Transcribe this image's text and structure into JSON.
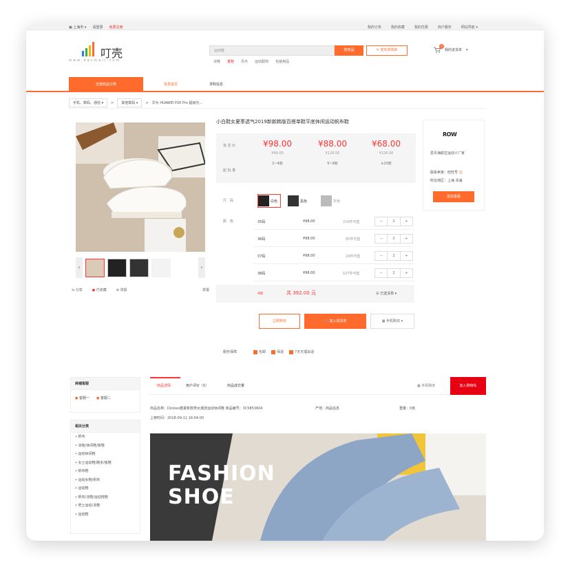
{
  "topbar": {
    "city": "上海市",
    "login": "请登录",
    "register": "免费注册",
    "links": [
      "我的订单",
      "我的收藏",
      "我的优惠",
      "商户服务",
      "网站导航"
    ]
  },
  "brand": {
    "name": "叮壳",
    "url": "www.dacmall.com"
  },
  "search": {
    "placeholder": "运动鞋",
    "button": "搜商品",
    "publish": "发布求购单",
    "hot_words": [
      "凉鞋",
      "童鞋",
      "丹杰",
      "运动服饰",
      "包装用品"
    ]
  },
  "cart": {
    "label": "我的进货单",
    "count": "0"
  },
  "nav": {
    "tabs": [
      "全部商品分类",
      "批发首页",
      "求购信息"
    ]
  },
  "breadcrumb": {
    "cat1": "手机、数码、通信",
    "cat2": "其他数码",
    "current": "华为 HUAWEI P20 Pro 超级光..."
  },
  "product": {
    "title": "小白鞋女夏季透气2019新款韩版百搭单鞋平底休闲运动帆布鞋",
    "price_label": "批 发 价",
    "qty_label": "起 批 量",
    "tiers": [
      {
        "price": "¥98.00",
        "orig": "¥99.00",
        "qty": "1~4双"
      },
      {
        "price": "¥88.00",
        "orig": "¥126.00",
        "qty": "5~9双"
      },
      {
        "price": "¥68.00",
        "orig": "¥126.00",
        "qty": "≥10双"
      }
    ],
    "style_label": "尺　码",
    "styles": [
      "白色",
      "黑色",
      "灰色"
    ],
    "color_label": "颜　色",
    "sizes": [
      {
        "size": "35码",
        "price": "¥98.00",
        "stock": "216件可售",
        "qty": "2"
      },
      {
        "size": "36码",
        "price": "¥98.00",
        "stock": "85件可售",
        "qty": "2"
      },
      {
        "size": "37码",
        "price": "¥98.00",
        "stock": "24件可售",
        "qty": "2"
      },
      {
        "size": "38码",
        "price": "¥98.00",
        "stock": "107件可售",
        "qty": "2"
      }
    ],
    "total_count": "4双",
    "total_price": "共 392.00 元",
    "selected": "已选清单",
    "buy_now": "立即购买",
    "add_cart": "加入进货单",
    "mobile_buy": "手机购买",
    "service_label": "服务保障",
    "services": [
      "包邮",
      "保退",
      "7天无理由退"
    ]
  },
  "gallery": {
    "share": "分享",
    "fav": "已收藏",
    "report": "举报",
    "more": "举报"
  },
  "seller": {
    "logo": "ROW",
    "name": "爱丹海航拉运动人厂家",
    "contact_label": "联系卖家：",
    "contact": "旺旺号",
    "region_label": "所在地区：",
    "region": "上海 青浦",
    "button": "进店看看"
  },
  "sidebar": {
    "service_title": "商铺客服",
    "agents": [
      "客服一",
      "客服二"
    ],
    "category_title": "相关分类",
    "categories": [
      "帆布",
      "凉拖/休闲鞋/板鞋",
      "运动休闲鞋",
      "女士运动鞋/跑步/板鞋",
      "帆布鞋",
      "运动女鞋/帆布",
      "运动鞋",
      "帆布/凉鞋/运动拖鞋",
      "男士运动/凉鞋",
      "运动鞋"
    ]
  },
  "detail": {
    "tabs": [
      "商品详情",
      "用户评价（5）",
      "商品成交量"
    ],
    "mobile": "手机购买",
    "add_cart": "加入购物车",
    "attr_name": "商品名称：Dickies春夏新款男女潮流运动休闲鞋 商品编号：3C5853604",
    "attr_origin": "产地：商品信息",
    "attr_weight": "重量：0克",
    "attr_time": "上架时间：2018-09-11 16:04:00"
  },
  "banner": {
    "line1": "FASHION",
    "line2": "SHOE"
  },
  "colors": {
    "accent": "#ff6a2d",
    "price": "#ff3333"
  }
}
